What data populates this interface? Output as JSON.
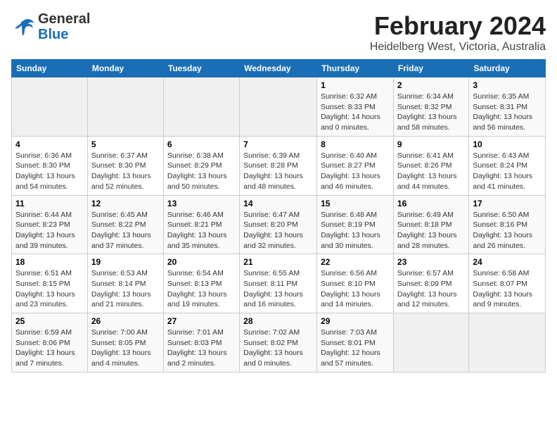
{
  "header": {
    "logo_general": "General",
    "logo_blue": "Blue",
    "title": "February 2024",
    "subtitle": "Heidelberg West, Victoria, Australia"
  },
  "calendar": {
    "days_of_week": [
      "Sunday",
      "Monday",
      "Tuesday",
      "Wednesday",
      "Thursday",
      "Friday",
      "Saturday"
    ],
    "weeks": [
      [
        {
          "day": "",
          "info": ""
        },
        {
          "day": "",
          "info": ""
        },
        {
          "day": "",
          "info": ""
        },
        {
          "day": "",
          "info": ""
        },
        {
          "day": "1",
          "info": "Sunrise: 6:32 AM\nSunset: 8:33 PM\nDaylight: 14 hours\nand 0 minutes."
        },
        {
          "day": "2",
          "info": "Sunrise: 6:34 AM\nSunset: 8:32 PM\nDaylight: 13 hours\nand 58 minutes."
        },
        {
          "day": "3",
          "info": "Sunrise: 6:35 AM\nSunset: 8:31 PM\nDaylight: 13 hours\nand 56 minutes."
        }
      ],
      [
        {
          "day": "4",
          "info": "Sunrise: 6:36 AM\nSunset: 8:30 PM\nDaylight: 13 hours\nand 54 minutes."
        },
        {
          "day": "5",
          "info": "Sunrise: 6:37 AM\nSunset: 8:30 PM\nDaylight: 13 hours\nand 52 minutes."
        },
        {
          "day": "6",
          "info": "Sunrise: 6:38 AM\nSunset: 8:29 PM\nDaylight: 13 hours\nand 50 minutes."
        },
        {
          "day": "7",
          "info": "Sunrise: 6:39 AM\nSunset: 8:28 PM\nDaylight: 13 hours\nand 48 minutes."
        },
        {
          "day": "8",
          "info": "Sunrise: 6:40 AM\nSunset: 8:27 PM\nDaylight: 13 hours\nand 46 minutes."
        },
        {
          "day": "9",
          "info": "Sunrise: 6:41 AM\nSunset: 8:26 PM\nDaylight: 13 hours\nand 44 minutes."
        },
        {
          "day": "10",
          "info": "Sunrise: 6:43 AM\nSunset: 8:24 PM\nDaylight: 13 hours\nand 41 minutes."
        }
      ],
      [
        {
          "day": "11",
          "info": "Sunrise: 6:44 AM\nSunset: 8:23 PM\nDaylight: 13 hours\nand 39 minutes."
        },
        {
          "day": "12",
          "info": "Sunrise: 6:45 AM\nSunset: 8:22 PM\nDaylight: 13 hours\nand 37 minutes."
        },
        {
          "day": "13",
          "info": "Sunrise: 6:46 AM\nSunset: 8:21 PM\nDaylight: 13 hours\nand 35 minutes."
        },
        {
          "day": "14",
          "info": "Sunrise: 6:47 AM\nSunset: 8:20 PM\nDaylight: 13 hours\nand 32 minutes."
        },
        {
          "day": "15",
          "info": "Sunrise: 6:48 AM\nSunset: 8:19 PM\nDaylight: 13 hours\nand 30 minutes."
        },
        {
          "day": "16",
          "info": "Sunrise: 6:49 AM\nSunset: 8:18 PM\nDaylight: 13 hours\nand 28 minutes."
        },
        {
          "day": "17",
          "info": "Sunrise: 6:50 AM\nSunset: 8:16 PM\nDaylight: 13 hours\nand 26 minutes."
        }
      ],
      [
        {
          "day": "18",
          "info": "Sunrise: 6:51 AM\nSunset: 8:15 PM\nDaylight: 13 hours\nand 23 minutes."
        },
        {
          "day": "19",
          "info": "Sunrise: 6:53 AM\nSunset: 8:14 PM\nDaylight: 13 hours\nand 21 minutes."
        },
        {
          "day": "20",
          "info": "Sunrise: 6:54 AM\nSunset: 8:13 PM\nDaylight: 13 hours\nand 19 minutes."
        },
        {
          "day": "21",
          "info": "Sunrise: 6:55 AM\nSunset: 8:11 PM\nDaylight: 13 hours\nand 16 minutes."
        },
        {
          "day": "22",
          "info": "Sunrise: 6:56 AM\nSunset: 8:10 PM\nDaylight: 13 hours\nand 14 minutes."
        },
        {
          "day": "23",
          "info": "Sunrise: 6:57 AM\nSunset: 8:09 PM\nDaylight: 13 hours\nand 12 minutes."
        },
        {
          "day": "24",
          "info": "Sunrise: 6:58 AM\nSunset: 8:07 PM\nDaylight: 13 hours\nand 9 minutes."
        }
      ],
      [
        {
          "day": "25",
          "info": "Sunrise: 6:59 AM\nSunset: 8:06 PM\nDaylight: 13 hours\nand 7 minutes."
        },
        {
          "day": "26",
          "info": "Sunrise: 7:00 AM\nSunset: 8:05 PM\nDaylight: 13 hours\nand 4 minutes."
        },
        {
          "day": "27",
          "info": "Sunrise: 7:01 AM\nSunset: 8:03 PM\nDaylight: 13 hours\nand 2 minutes."
        },
        {
          "day": "28",
          "info": "Sunrise: 7:02 AM\nSunset: 8:02 PM\nDaylight: 13 hours\nand 0 minutes."
        },
        {
          "day": "29",
          "info": "Sunrise: 7:03 AM\nSunset: 8:01 PM\nDaylight: 12 hours\nand 57 minutes."
        },
        {
          "day": "",
          "info": ""
        },
        {
          "day": "",
          "info": ""
        }
      ]
    ]
  }
}
